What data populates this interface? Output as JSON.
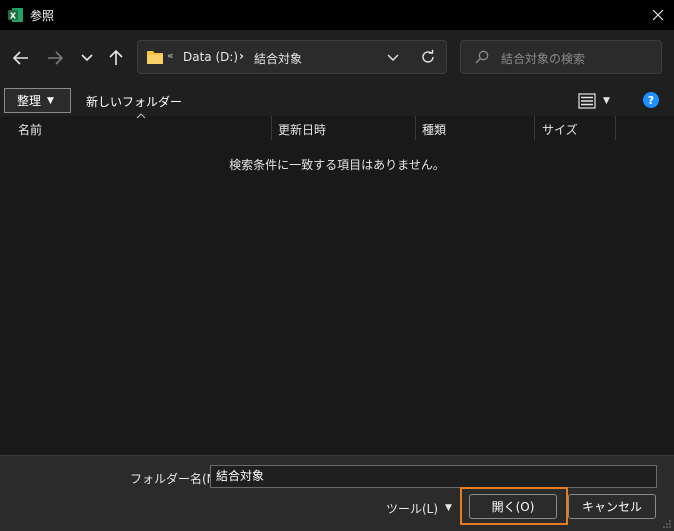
{
  "window": {
    "title": "参照"
  },
  "address": {
    "overflow": "«",
    "crumbs": [
      "Data (D:)",
      "結合対象"
    ],
    "separator": "›"
  },
  "search": {
    "placeholder": "結合対象の検索"
  },
  "toolbar": {
    "organize_label": "整理",
    "new_folder_label": "新しいフォルダー",
    "help_label": "?"
  },
  "columns": {
    "name": "名前",
    "modified": "更新日時",
    "type": "種類",
    "size": "サイズ"
  },
  "list": {
    "empty_message": "検索条件に一致する項目はありません。"
  },
  "footer": {
    "folder_name_label": "フォルダー名(N):",
    "folder_name_value": "結合対象",
    "tools_label": "ツール(L)",
    "open_label": "開く(O)",
    "cancel_label": "キャンセル"
  },
  "colors": {
    "accent_focus": "#e57c22",
    "help_blue": "#1e90ff",
    "folder_yellow": "#f4c542",
    "excel_green": "#1d6f42"
  },
  "icons": [
    "excel-app-icon",
    "close-icon",
    "back-arrow-icon",
    "forward-arrow-icon",
    "recent-dropdown-icon",
    "up-arrow-icon",
    "folder-icon",
    "chevron-down-icon",
    "refresh-icon",
    "search-icon",
    "view-options-icon",
    "help-icon",
    "resize-grip-icon"
  ]
}
